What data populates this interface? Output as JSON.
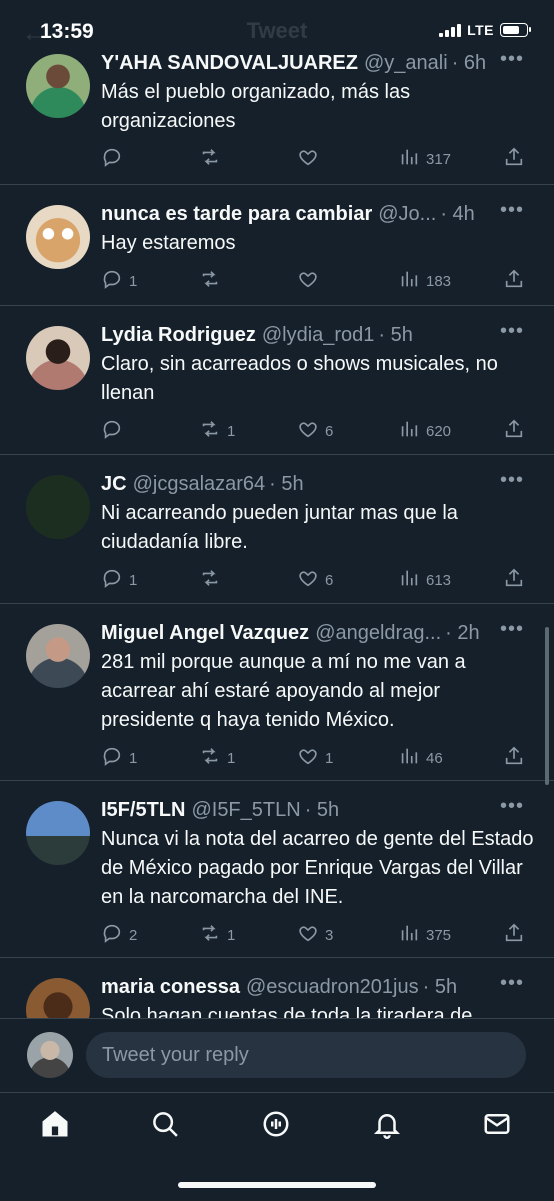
{
  "status": {
    "time": "13:59",
    "network": "LTE"
  },
  "header": {
    "title": "Tweet"
  },
  "tweets": [
    {
      "name": "Y'AHA SANDOVALJUAREZ",
      "handle": "@y_anali",
      "time": "· 6h",
      "text": "Más el pueblo organizado, más las organizaciones",
      "replies": "",
      "retweets": "",
      "likes": "",
      "views": "317"
    },
    {
      "name": "nunca es tarde para cambiar",
      "handle": "@Jo...",
      "time": "· 4h",
      "text": "Hay estaremos",
      "replies": "1",
      "retweets": "",
      "likes": "",
      "views": "183"
    },
    {
      "name": "Lydia Rodriguez",
      "handle": "@lydia_rod1",
      "time": "· 5h",
      "text": "Claro, sin acarreados o shows musicales, no llenan",
      "replies": "",
      "retweets": "1",
      "likes": "6",
      "views": "620"
    },
    {
      "name": "JC",
      "handle": "@jcgsalazar64",
      "time": "· 5h",
      "text": "Ni acarreando pueden juntar mas que la ciudadanía libre.",
      "replies": "1",
      "retweets": "",
      "likes": "6",
      "views": "613"
    },
    {
      "name": "Miguel Angel Vazquez",
      "handle": "@angeldrag...",
      "time": "· 2h",
      "text": "281 mil porque aunque a mí no me van a acarrear ahí estaré apoyando al mejor presidente q haya tenido México.",
      "replies": "1",
      "retweets": "1",
      "likes": "1",
      "views": "46"
    },
    {
      "name": "I5F/5TLN",
      "handle": "@I5F_5TLN",
      "time": "· 5h",
      "text": "Nunca vi la nota del acarreo de gente del Estado de México pagado por Enrique Vargas del Villar en la narcomarcha del INE.",
      "replies": "2",
      "retweets": "1",
      "likes": "3",
      "views": "375"
    },
    {
      "name": "maria conessa",
      "handle": "@escuadron201jus",
      "time": "· 5h",
      "text": "Solo hagan cuentas de toda la tiradera de",
      "replies": "",
      "retweets": "",
      "likes": "",
      "views": ""
    }
  ],
  "reply": {
    "placeholder": "Tweet your reply"
  },
  "icons": {
    "more": "more-horizontal-icon",
    "reply": "reply-icon",
    "retweet": "retweet-icon",
    "like": "heart-icon",
    "views": "views-icon",
    "share": "share-icon",
    "tabs": [
      "home-icon",
      "search-icon",
      "spaces-icon",
      "notifications-icon",
      "messages-icon"
    ]
  },
  "colors": {
    "background": "#15202b",
    "secondary_text": "#8b98a5",
    "divider": "#38444d"
  }
}
